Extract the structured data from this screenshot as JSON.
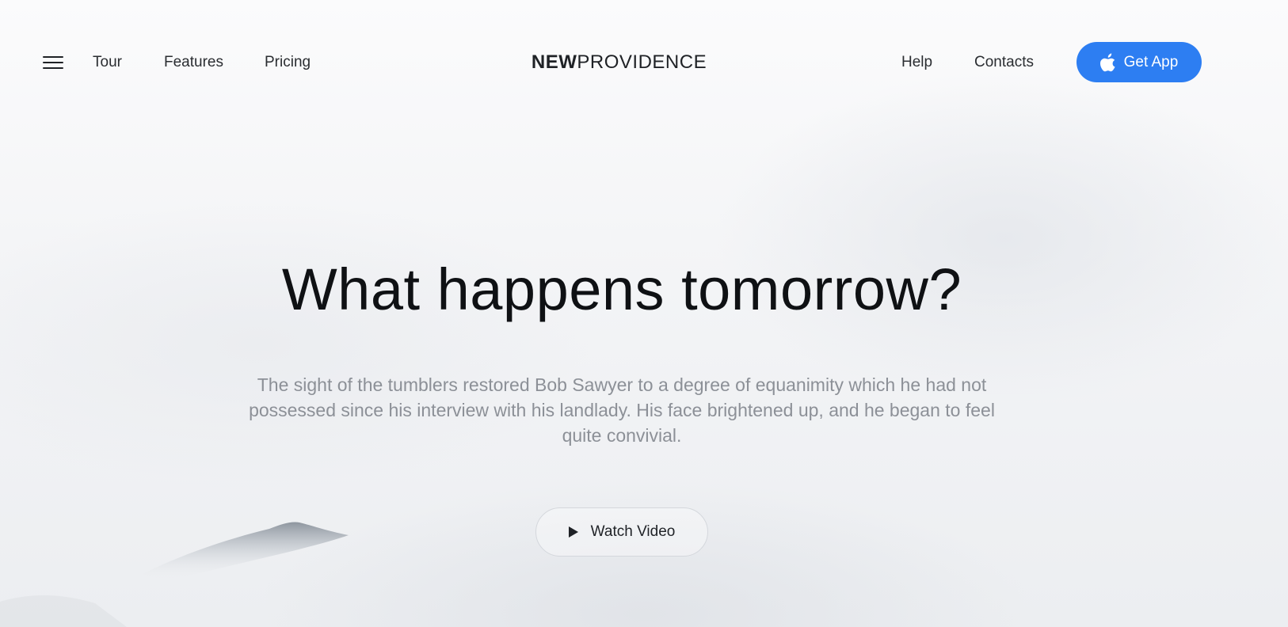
{
  "nav": {
    "menu_icon": "hamburger-menu-icon",
    "left_links": [
      "Tour",
      "Features",
      "Pricing"
    ],
    "logo_bold": "NEW",
    "logo_light": "PROVIDENCE",
    "right_links": [
      "Help",
      "Contacts"
    ],
    "cta_label": "Get App",
    "cta_icon": "apple-icon"
  },
  "hero": {
    "headline": "What happens tomorrow?",
    "lead": "The sight of the tumblers restored Bob Sawyer to a degree of equanimity which he had not possessed since his interview with his landlady. His face brightened up, and he began to feel quite convivial.",
    "video_label": "Watch Video",
    "video_icon": "play-icon"
  },
  "colors": {
    "accent": "#2d7ef2",
    "text": "#1f2226",
    "muted": "#8c9097"
  }
}
